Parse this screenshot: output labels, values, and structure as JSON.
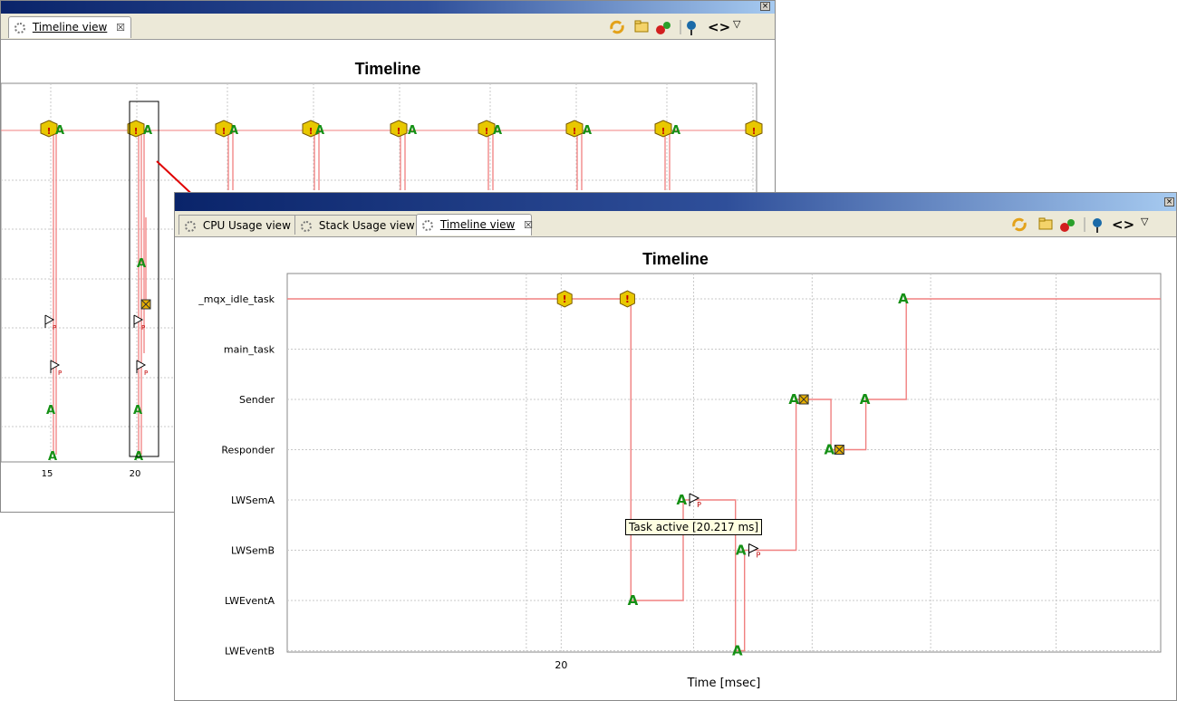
{
  "back_window": {
    "close_glyph": "×",
    "tab": {
      "label": "Timeline view",
      "close_glyph": "☒"
    },
    "chart_title": "Timeline",
    "x_ticks": [
      "15",
      "20"
    ]
  },
  "front_window": {
    "close_glyph": "×",
    "tabs": [
      {
        "label": "CPU Usage view",
        "active": false
      },
      {
        "label": "Stack Usage view",
        "active": false
      },
      {
        "label": "Timeline view",
        "active": true,
        "close_glyph": "☒"
      }
    ],
    "toolbar_icons": [
      "refresh-icon",
      "open-folder-icon",
      "tasks-icon",
      "filter-icon",
      "code-icon",
      "view-menu-icon"
    ],
    "toolbar_glyphs": {
      "code": "<>",
      "menu": "▽"
    },
    "chart_title": "Timeline",
    "x_axis_label": "Time [msec]",
    "tooltip": "Task active [20.217 ms]"
  },
  "chart_data": {
    "type": "timeline",
    "title": "Timeline",
    "xlabel": "Time [msec]",
    "ylabel": "",
    "tasks": [
      "_mqx_idle_task",
      "main_task",
      "Sender",
      "Responder",
      "LWSemA",
      "LWSemB",
      "LWEventA",
      "LWEventB"
    ],
    "x_ticks": [
      20
    ],
    "xlim": [
      16.07,
      28.6
    ],
    "active_path": [
      {
        "t": 16.07,
        "task": "_mqx_idle_task"
      },
      {
        "t": 21.0,
        "task": "_mqx_idle_task"
      },
      {
        "t": 21.0,
        "task": "LWEventA"
      },
      {
        "t": 21.75,
        "task": "LWEventA"
      },
      {
        "t": 21.75,
        "task": "LWSemA"
      },
      {
        "t": 22.5,
        "task": "LWSemA"
      },
      {
        "t": 22.5,
        "task": "LWEventB"
      },
      {
        "t": 22.63,
        "task": "LWEventB"
      },
      {
        "t": 22.63,
        "task": "LWSemB"
      },
      {
        "t": 23.37,
        "task": "LWSemB"
      },
      {
        "t": 23.37,
        "task": "Sender"
      },
      {
        "t": 23.87,
        "task": "Sender"
      },
      {
        "t": 23.87,
        "task": "Responder"
      },
      {
        "t": 24.37,
        "task": "Responder"
      },
      {
        "t": 24.37,
        "task": "Sender"
      },
      {
        "t": 24.95,
        "task": "Sender"
      },
      {
        "t": 24.95,
        "task": "_mqx_idle_task"
      },
      {
        "t": 28.6,
        "task": "_mqx_idle_task"
      }
    ],
    "events": [
      {
        "t": 20.05,
        "task": "_mqx_idle_task",
        "kind": "interrupt"
      },
      {
        "t": 20.95,
        "task": "_mqx_idle_task",
        "kind": "interrupt"
      },
      {
        "t": 21.03,
        "task": "LWEventA",
        "kind": "task-active"
      },
      {
        "t": 21.73,
        "task": "LWSemA",
        "kind": "task-active"
      },
      {
        "t": 21.92,
        "task": "LWSemA",
        "kind": "semaphore-post"
      },
      {
        "t": 22.53,
        "task": "LWEventB",
        "kind": "task-active"
      },
      {
        "t": 22.58,
        "task": "LWSemB",
        "kind": "task-active"
      },
      {
        "t": 22.77,
        "task": "LWSemB",
        "kind": "semaphore-post"
      },
      {
        "t": 23.34,
        "task": "Sender",
        "kind": "task-active"
      },
      {
        "t": 23.48,
        "task": "Sender",
        "kind": "message"
      },
      {
        "t": 23.85,
        "task": "Responder",
        "kind": "task-active"
      },
      {
        "t": 23.99,
        "task": "Responder",
        "kind": "message"
      },
      {
        "t": 24.36,
        "task": "Sender",
        "kind": "task-active"
      },
      {
        "t": 24.91,
        "task": "_mqx_idle_task",
        "kind": "task-active"
      }
    ],
    "grid": true
  },
  "colors": {
    "trace": "#f08080",
    "task_active": "#159015",
    "interrupt": "#e8c800",
    "message": "#e8b000",
    "grid": "#c8c8c8"
  }
}
